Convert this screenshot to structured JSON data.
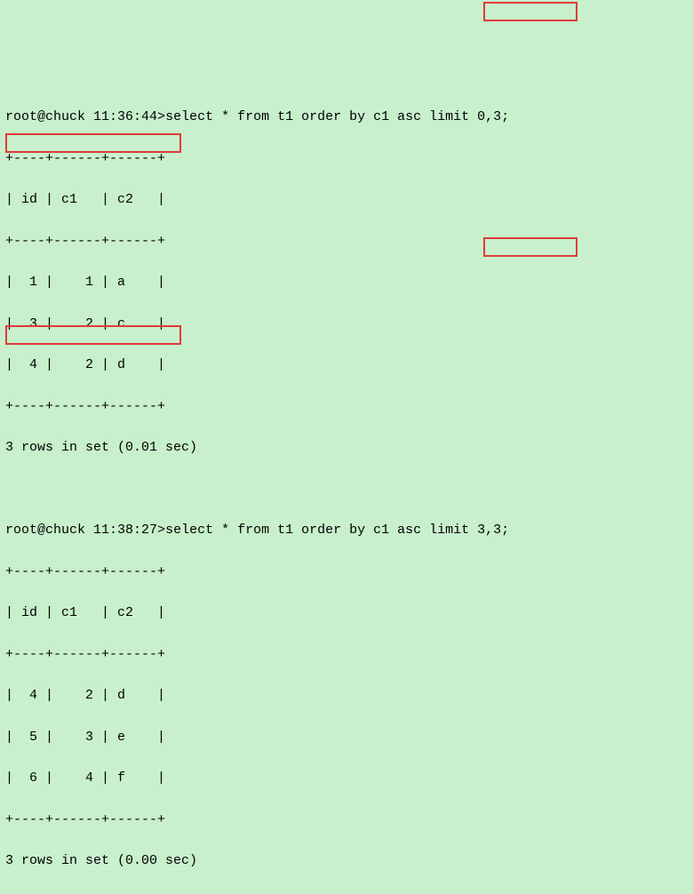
{
  "queries": [
    {
      "prompt_label": "root@chuck",
      "prompt_time": "11:36:44",
      "prompt_sep": ">",
      "sql_before_limit": "select * from t1 order by c1 asc ",
      "limit_clause": "limit 0,3;",
      "table": {
        "border_top": "+----+------+------+",
        "header": "| id | c1   | c2   |",
        "border_hdr": "+----+------+------+",
        "rows": [
          {
            "text": "|  1 |    1 | a    |",
            "id": 1,
            "c1": 1,
            "c2": "a"
          },
          {
            "text": "|  3 |    2 | c    |",
            "id": 3,
            "c1": 2,
            "c2": "c"
          },
          {
            "text": "|  4 |    2 | d    |",
            "id": 4,
            "c1": 2,
            "c2": "d"
          }
        ],
        "border_bot": "+----+------+------+"
      },
      "footer": "3 rows in set (0.01 sec)",
      "highlighted_row_index": 2
    },
    {
      "prompt_label": "root@chuck",
      "prompt_time": "11:38:27",
      "prompt_sep": ">",
      "sql_before_limit": "select * from t1 order by c1 asc ",
      "limit_clause": "limit 3,3;",
      "table": {
        "border_top": "+----+------+------+",
        "header": "| id | c1   | c2   |",
        "border_hdr": "+----+------+------+",
        "rows": [
          {
            "text": "|  4 |    2 | d    |",
            "id": 4,
            "c1": 2,
            "c2": "d"
          },
          {
            "text": "|  5 |    3 | e    |",
            "id": 5,
            "c1": 3,
            "c2": "e"
          },
          {
            "text": "|  6 |    4 | f    |",
            "id": 6,
            "c1": 4,
            "c2": "f"
          }
        ],
        "border_bot": "+----+------+------+"
      },
      "footer": "3 rows in set (0.00 sec)",
      "highlighted_row_index": 0
    }
  ],
  "blank_line": "",
  "highlight_color": "#e03a3a"
}
